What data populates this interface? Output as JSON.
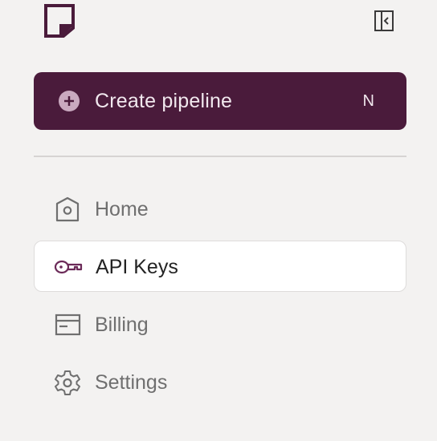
{
  "header": {
    "logo_icon": "logo-page-icon",
    "collapse_icon": "sidebar-collapse-icon"
  },
  "create_button": {
    "label": "Create pipeline",
    "shortcut": "N",
    "icon": "plus-circle-icon"
  },
  "nav": {
    "items": [
      {
        "label": "Home",
        "icon": "home-icon",
        "active": false
      },
      {
        "label": "API Keys",
        "icon": "key-icon",
        "active": true
      },
      {
        "label": "Billing",
        "icon": "credit-card-icon",
        "active": false
      },
      {
        "label": "Settings",
        "icon": "gear-icon",
        "active": false
      }
    ]
  },
  "colors": {
    "brand": "#4a1b3b",
    "background": "#f3f2f1",
    "active_bg": "#ffffff",
    "muted_text": "#6f6f6f"
  }
}
